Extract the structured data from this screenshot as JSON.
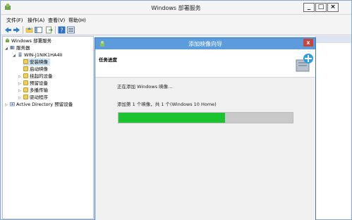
{
  "window": {
    "title": "Windows 部署服务"
  },
  "menubar": {
    "items": [
      {
        "label": "文件(F)"
      },
      {
        "label": "操作(A)"
      },
      {
        "label": "查看(V)"
      },
      {
        "label": "帮助(H)"
      }
    ]
  },
  "toolbar": {
    "icons": [
      "back-icon",
      "forward-icon",
      "folder-up-icon",
      "show-hide-tree-icon",
      "export-list-icon",
      "help-icon",
      "properties-icon"
    ]
  },
  "tree": {
    "items": [
      {
        "label": "Windows 部署服务"
      },
      {
        "label": "服务器"
      },
      {
        "label": "WIN-J1NIK1HA4II"
      },
      {
        "label": "安装映像"
      },
      {
        "label": "启动映像"
      },
      {
        "label": "挂起的设备"
      },
      {
        "label": "预留设备"
      },
      {
        "label": "多播传输"
      },
      {
        "label": "驱动程序"
      },
      {
        "label": "Active Directory 预留设备"
      }
    ]
  },
  "dialog": {
    "title": "添加映像向导",
    "section": "任务进度",
    "status": "正在添加 Windows 映像...",
    "detail": "添加第 1 个映像，共 1 个(Windows 10 Home)",
    "progress": 0.61,
    "close_label": "x"
  },
  "colors": {
    "progress": "#1bc42f",
    "dialog_title_bar": "#5d9cdc",
    "close_button": "#c9443b"
  }
}
